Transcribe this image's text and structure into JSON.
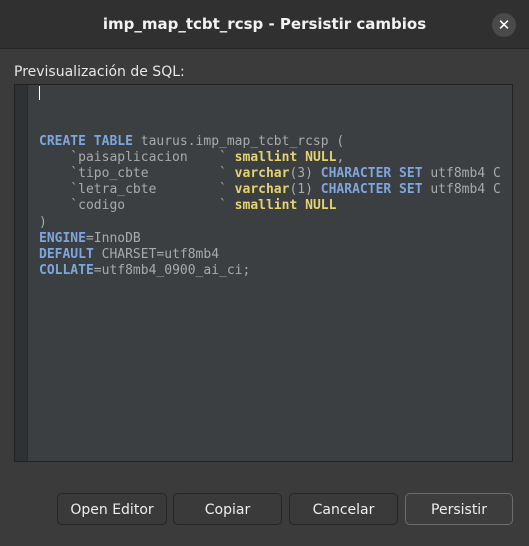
{
  "window": {
    "title": "imp_map_tcbt_rcsp - Persistir cambios",
    "close_glyph": "✕"
  },
  "preview_label": "Previsualización de SQL:",
  "sql_lines": [
    [
      {
        "t": "CREATE TABLE",
        "c": "kw"
      },
      {
        "t": " taurus.imp_map_tcbt_rcsp (",
        "c": "id"
      }
    ],
    [
      {
        "t": "    `paisaplicacion    `",
        "c": "id"
      },
      {
        "t": " smallint",
        "c": "ty"
      },
      {
        "t": " ",
        "c": "id"
      },
      {
        "t": "NULL",
        "c": "ty"
      },
      {
        "t": ",",
        "c": "id"
      }
    ],
    [
      {
        "t": "    `tipo_cbte         `",
        "c": "id"
      },
      {
        "t": " varchar",
        "c": "ty"
      },
      {
        "t": "(3) ",
        "c": "id"
      },
      {
        "t": "CHARACTER SET",
        "c": "kw"
      },
      {
        "t": " utf8mb4 C",
        "c": "id"
      }
    ],
    [
      {
        "t": "    `letra_cbte        `",
        "c": "id"
      },
      {
        "t": " varchar",
        "c": "ty"
      },
      {
        "t": "(1) ",
        "c": "id"
      },
      {
        "t": "CHARACTER SET",
        "c": "kw"
      },
      {
        "t": " utf8mb4 C",
        "c": "id"
      }
    ],
    [
      {
        "t": "    `codigo            `",
        "c": "id"
      },
      {
        "t": " smallint",
        "c": "ty"
      },
      {
        "t": " ",
        "c": "id"
      },
      {
        "t": "NULL",
        "c": "ty"
      }
    ],
    [
      {
        "t": ")",
        "c": "id"
      }
    ],
    [
      {
        "t": "ENGINE",
        "c": "kw"
      },
      {
        "t": "=InnoDB",
        "c": "id"
      }
    ],
    [
      {
        "t": "DEFAULT",
        "c": "kw"
      },
      {
        "t": " CHARSET=utf8mb4",
        "c": "id"
      }
    ],
    [
      {
        "t": "COLLATE",
        "c": "kw"
      },
      {
        "t": "=utf8mb4_0900_ai_ci;",
        "c": "id"
      }
    ]
  ],
  "buttons": {
    "open_editor": "Open Editor",
    "copy": "Copiar",
    "cancel": "Cancelar",
    "persist": "Persistir"
  }
}
